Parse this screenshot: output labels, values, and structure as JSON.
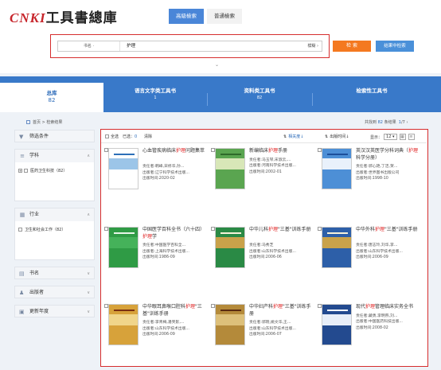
{
  "header": {
    "logo_brand": "CNKI",
    "logo_text": "工具書總庫",
    "tabs": [
      {
        "label": "高級檢索",
        "active": true
      },
      {
        "label": "普通檢索",
        "active": false
      }
    ],
    "search": {
      "field": "书名",
      "field_arrow": "·",
      "value": "护理",
      "mode": "模糊",
      "mode_arrow": "›"
    },
    "search_button": "检 索",
    "subsearch_button": "结果中检索",
    "collapse_icon": "chevron-down"
  },
  "categories": [
    {
      "label": "总库",
      "count": "82",
      "active": true
    },
    {
      "label": "语言文字类工具书",
      "count": "1",
      "active": false
    },
    {
      "label": "资料类工具书",
      "count": "82",
      "active": false
    },
    {
      "label": "检索性工具书",
      "count": "",
      "active": false
    }
  ],
  "breadcrumb": {
    "home": "首页",
    "current": "检索结果"
  },
  "sidebar": {
    "filter_title": "筛选条件",
    "groups": [
      {
        "title": "学科",
        "item": "医药卫生科技（82）",
        "toggle": "+"
      },
      {
        "title": "行业",
        "item": "卫生和社会工作（82）",
        "toggle": ""
      }
    ],
    "collapsed": [
      {
        "title": "书名"
      },
      {
        "title": "出版者"
      },
      {
        "title": "更新年度"
      }
    ]
  },
  "status": {
    "prefix": "共找到",
    "total": "82",
    "suffix": "条结果",
    "page": "1",
    "pages": "/7",
    "next": "›"
  },
  "toolbar": {
    "select_all": "全选",
    "selected_prefix": "已选：",
    "selected_count": "0",
    "clear": "清除",
    "sort_relevance": "相关度",
    "sort_date": "出版时间",
    "show_label": "显示：",
    "show_count": "12"
  },
  "books": [
    {
      "title": "心血管疾病临床护理问题集萃",
      "hl": "护理",
      "responsible": "责任者:韩峰,宋修华,孙...",
      "publisher": "出版者:辽宁科学技术出版...",
      "date": "出版时间:2020-02",
      "cover": {
        "bg": "#ffffff",
        "accent": "#9cc5e8",
        "text": "#2d6fb8"
      }
    },
    {
      "title": "新编临床护理手册",
      "hl": "护理",
      "responsible": "责任者:马玉琴,宋淑云,...",
      "publisher": "出版者:河南科学技术出版...",
      "date": "出版时间:2002-01",
      "cover": {
        "bg": "#5aa550",
        "accent": "#d8e7b8",
        "text": "#2f6a2a"
      }
    },
    {
      "title": "英汉汉英医学分科词典（护理科学分册）",
      "hl": "护理",
      "responsible": "责任者:郭心艳,丁洁,贺...",
      "publisher": "出版者:世界图书出版公司",
      "date": "出版时间:1998-10",
      "cover": {
        "bg": "#4d8fd6",
        "accent": "#e9f1fb",
        "text": "#1d4f9a"
      }
    },
    {
      "title": "中国医学百科全书（六十四）护理学",
      "hl": "护理",
      "responsible": "责任者:中国医学百科全...",
      "publisher": "出版者:上海科学技术出版...",
      "date": "出版时间:1986-09",
      "cover": {
        "bg": "#2f9b45",
        "accent": "#45b25a",
        "text": "#e8f5e8"
      }
    },
    {
      "title": "中华儿科护理\"三基\"训练手册",
      "hl": "护理",
      "responsible": "责任者:马秀芝",
      "publisher": "出版者:山东科学技术出版...",
      "date": "出版时间:2006-06",
      "cover": {
        "bg": "#2a8a45",
        "accent": "#c9a24a",
        "text": "#f7f2da"
      }
    },
    {
      "title": "中华外科护理\"三基\"训练手册",
      "hl": "护理",
      "responsible": "责任者:唐志玲,刘华,李...",
      "publisher": "出版者:山东科学技术出版...",
      "date": "出版时间:2006-09",
      "cover": {
        "bg": "#2d5fa8",
        "accent": "#c9a24a",
        "text": "#f7f2da"
      }
    },
    {
      "title": "中华眼耳鼻喉口腔科护理\"三基\"训练手册",
      "hl": "护理",
      "responsible": "责任者:李青梅,潘笑影,...",
      "publisher": "出版者:山东科学技术出版...",
      "date": "出版时间:2006-09",
      "cover": {
        "bg": "#d7a23a",
        "accent": "#f0d58a",
        "text": "#7a2f10"
      }
    },
    {
      "title": "中华妇产科护理\"三基\"训练手册",
      "hl": "护理",
      "responsible": "责任者:郭晓,姚文华,王...",
      "publisher": "出版者:山东科学技术出版...",
      "date": "出版时间:2006-07",
      "cover": {
        "bg": "#b48a3a",
        "accent": "#ddc07a",
        "text": "#5a2a10"
      }
    },
    {
      "title": "现代护理管理临床实务全书",
      "hl": "护理",
      "responsible": "责任者:藏勇,李明燕,刘...",
      "publisher": "出版者:中国医药科技出版...",
      "date": "出版时间:2008-02",
      "cover": {
        "bg": "#234a8f",
        "accent": "#e8eef8",
        "text": "#ffffff"
      }
    }
  ]
}
